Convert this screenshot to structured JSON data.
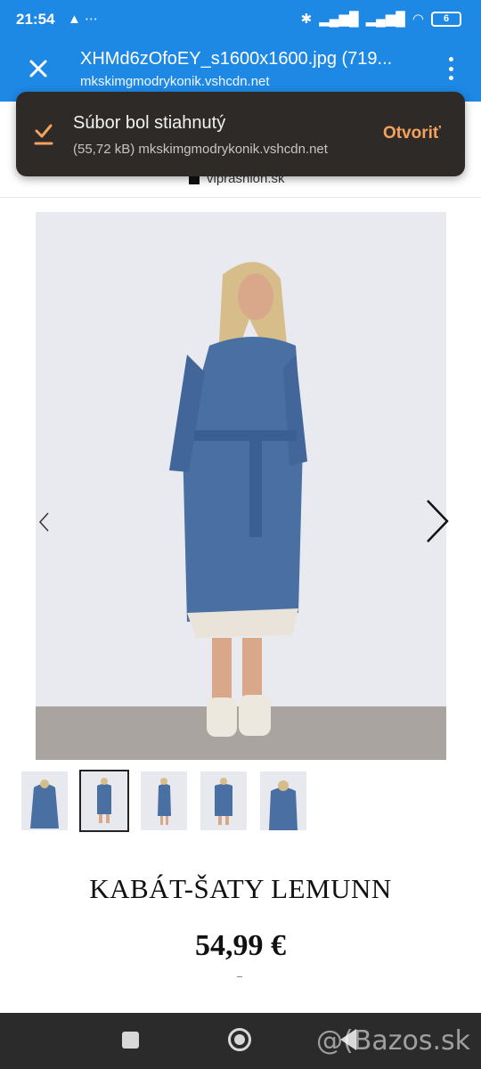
{
  "status_bar": {
    "time": "21:54",
    "left_icons": "▲ ⋯",
    "battery": "6"
  },
  "app_bar": {
    "title": "XHMd6zOfoEY_s1600x1600.jpg (719...",
    "host": "mkskimgmodrykonik.vshcdn.net"
  },
  "toast": {
    "title": "Súbor bol stiahnutý",
    "subtitle": "(55,72 kB) mkskimgmodrykonik.vshcdn.net",
    "action": "Otvoriť",
    "accent_color": "#f5a25d"
  },
  "site": {
    "name": "viprashion.sk"
  },
  "product": {
    "title": "KABÁT-ŠATY LEMUNN",
    "price": "54,99 €",
    "thumbnail_count": 5,
    "active_thumbnail": 2
  },
  "nav_bar": {
    "watermark": "@(Bazos.sk"
  },
  "colors": {
    "primary": "#1e88e5",
    "toast_bg": "#2e2a27",
    "nav_bg": "#2b2b2b"
  }
}
